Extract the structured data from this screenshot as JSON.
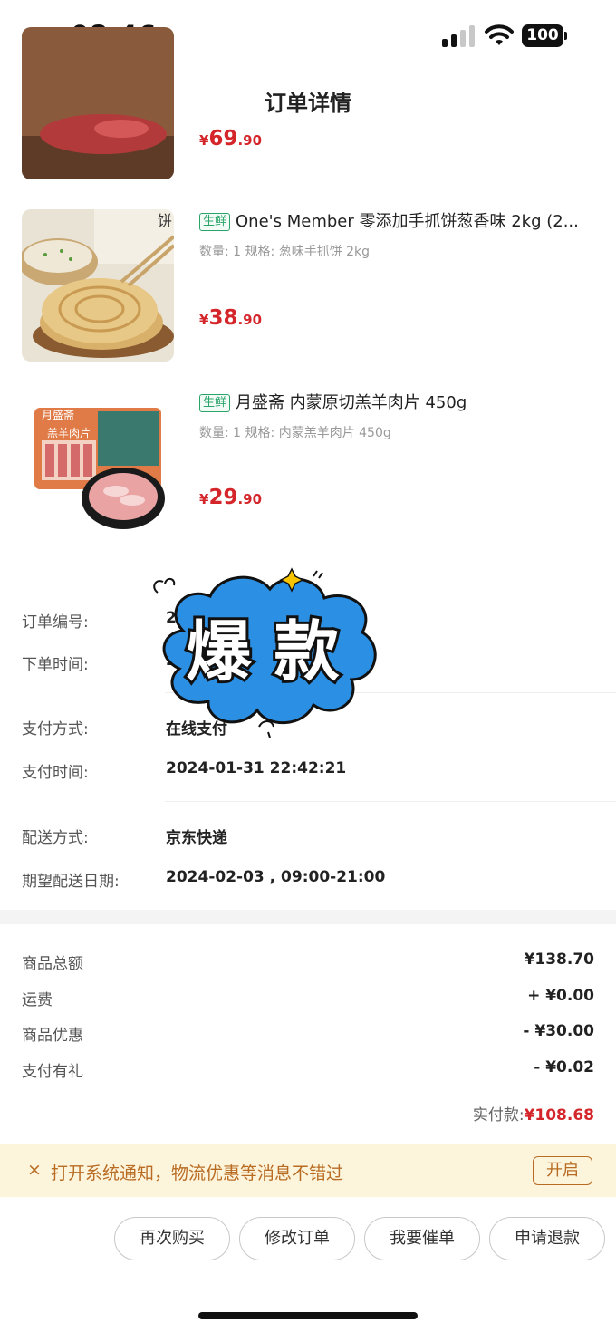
{
  "status_bar": {
    "time": "08:46",
    "battery": "100"
  },
  "nav": {
    "title": "订单详情"
  },
  "products": [
    {
      "price_yen": "¥",
      "price_int": "69",
      "price_dec": ".90"
    },
    {
      "tag": "生鲜",
      "title": "One's Member 零添加手抓饼葱香味 2kg (2...",
      "spec": "数量: 1 规格: 葱味手抓饼 2kg",
      "price_yen": "¥",
      "price_int": "38",
      "price_dec": ".90"
    },
    {
      "tag": "生鲜",
      "title": "月盛斋 内蒙原切羔羊肉片 450g",
      "spec": "数量: 1 规格: 内蒙羔羊肉片 450g",
      "price_yen": "¥",
      "price_int": "29",
      "price_dec": ".90"
    }
  ],
  "order_info": {
    "order_no_label": "订单编号:",
    "order_no_value": "2",
    "order_time_label": "下单时间:",
    "order_time_value": "20",
    "pay_method_label": "支付方式:",
    "pay_method_value": "在线支付",
    "pay_time_label": "支付时间:",
    "pay_time_value": "2024-01-31 22:42:21",
    "delivery_label": "配送方式:",
    "delivery_value": "京东快递",
    "expected_label": "期望配送日期:",
    "expected_value": "2024-02-03 , 09:00-21:00"
  },
  "amounts": {
    "goods_total_label": "商品总额",
    "goods_total_value": "¥138.70",
    "shipping_label": "运费",
    "shipping_value": "+ ¥0.00",
    "discount_label": "商品优惠",
    "discount_value": "- ¥30.00",
    "pay_gift_label": "支付有礼",
    "pay_gift_value": "- ¥0.02",
    "paid_label": "实付款:",
    "paid_value": "¥108.68"
  },
  "notice": {
    "close": "×",
    "text": "打开系统通知，物流优惠等消息不错过",
    "button": "开启"
  },
  "actions": {
    "rebuy": "再次购买",
    "modify": "修改订单",
    "urge": "我要催单",
    "refund": "申请退款"
  },
  "sticker": {
    "text": "爆 款"
  },
  "colors": {
    "price_red": "#d4262a",
    "fresh_green": "#2aa56a",
    "notice_bg": "#fdf4dc",
    "notice_text": "#b86b22",
    "sticker_blue": "#2b8fe3"
  }
}
